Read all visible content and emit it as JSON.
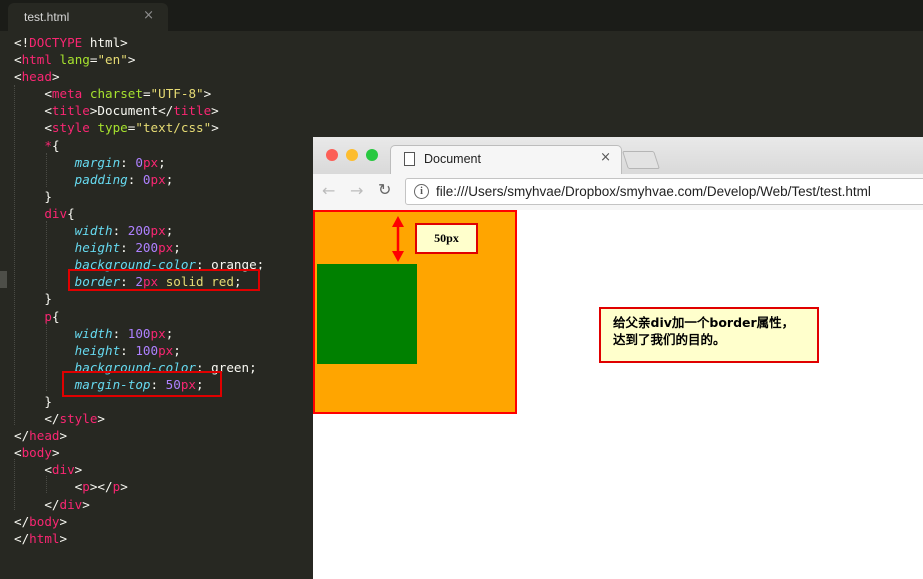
{
  "editor": {
    "tab": {
      "title": "test.html",
      "close": "×"
    },
    "lines": [
      [
        [
          "t-plain",
          "<!"
        ],
        [
          "t-tag",
          "DOCTYPE"
        ],
        [
          "t-plain",
          " html>"
        ]
      ],
      [
        [
          "t-plain",
          "<"
        ],
        [
          "t-tag",
          "html"
        ],
        [
          "t-plain",
          " "
        ],
        [
          "t-attr",
          "lang"
        ],
        [
          "t-plain",
          "="
        ],
        [
          "t-str",
          "\"en\""
        ],
        [
          "t-plain",
          ">"
        ]
      ],
      [
        [
          "t-plain",
          "<"
        ],
        [
          "t-tag",
          "head"
        ],
        [
          "t-plain",
          ">"
        ]
      ],
      [
        [
          "t-plain",
          "    <"
        ],
        [
          "t-tag",
          "meta"
        ],
        [
          "t-plain",
          " "
        ],
        [
          "t-attr",
          "charset"
        ],
        [
          "t-plain",
          "="
        ],
        [
          "t-str",
          "\"UTF-8\""
        ],
        [
          "t-plain",
          ">"
        ]
      ],
      [
        [
          "t-plain",
          "    <"
        ],
        [
          "t-tag",
          "title"
        ],
        [
          "t-plain",
          ">Document</"
        ],
        [
          "t-tag",
          "title"
        ],
        [
          "t-plain",
          ">"
        ]
      ],
      [
        [
          "t-plain",
          "    <"
        ],
        [
          "t-tag",
          "style"
        ],
        [
          "t-plain",
          " "
        ],
        [
          "t-attr",
          "type"
        ],
        [
          "t-plain",
          "="
        ],
        [
          "t-str",
          "\"text/css\""
        ],
        [
          "t-plain",
          ">"
        ]
      ],
      [
        [
          "t-plain",
          "    "
        ],
        [
          "t-tag",
          "*"
        ],
        [
          "t-plain",
          "{"
        ]
      ],
      [
        [
          "t-plain",
          "        "
        ],
        [
          "t-prop",
          "margin"
        ],
        [
          "t-plain",
          ": "
        ],
        [
          "t-num",
          "0"
        ],
        [
          "t-tag",
          "px"
        ],
        [
          "t-plain",
          ";"
        ]
      ],
      [
        [
          "t-plain",
          "        "
        ],
        [
          "t-prop",
          "padding"
        ],
        [
          "t-plain",
          ": "
        ],
        [
          "t-num",
          "0"
        ],
        [
          "t-tag",
          "px"
        ],
        [
          "t-plain",
          ";"
        ]
      ],
      [
        [
          "t-plain",
          "    }"
        ]
      ],
      [
        [
          "t-plain",
          "    "
        ],
        [
          "t-tag",
          "div"
        ],
        [
          "t-plain",
          "{"
        ]
      ],
      [
        [
          "t-plain",
          "        "
        ],
        [
          "t-prop",
          "width"
        ],
        [
          "t-plain",
          ": "
        ],
        [
          "t-num",
          "200"
        ],
        [
          "t-tag",
          "px"
        ],
        [
          "t-plain",
          ";"
        ]
      ],
      [
        [
          "t-plain",
          "        "
        ],
        [
          "t-prop",
          "height"
        ],
        [
          "t-plain",
          ": "
        ],
        [
          "t-num",
          "200"
        ],
        [
          "t-tag",
          "px"
        ],
        [
          "t-plain",
          ";"
        ]
      ],
      [
        [
          "t-plain",
          "        "
        ],
        [
          "t-prop",
          "background-color"
        ],
        [
          "t-plain",
          ": orange;"
        ]
      ],
      [
        [
          "t-plain",
          "        "
        ],
        [
          "t-prop",
          "border"
        ],
        [
          "t-plain",
          ": "
        ],
        [
          "t-num",
          "2"
        ],
        [
          "t-tag",
          "px"
        ],
        [
          "t-plain",
          " "
        ],
        [
          "t-str",
          "solid"
        ],
        [
          "t-plain",
          " "
        ],
        [
          "t-str",
          "red"
        ],
        [
          "t-plain",
          ";"
        ]
      ],
      [
        [
          "t-plain",
          "    }"
        ]
      ],
      [
        [
          "t-plain",
          "    "
        ],
        [
          "t-tag",
          "p"
        ],
        [
          "t-plain",
          "{"
        ]
      ],
      [
        [
          "t-plain",
          "        "
        ],
        [
          "t-prop",
          "width"
        ],
        [
          "t-plain",
          ": "
        ],
        [
          "t-num",
          "100"
        ],
        [
          "t-tag",
          "px"
        ],
        [
          "t-plain",
          ";"
        ]
      ],
      [
        [
          "t-plain",
          "        "
        ],
        [
          "t-prop",
          "height"
        ],
        [
          "t-plain",
          ": "
        ],
        [
          "t-num",
          "100"
        ],
        [
          "t-tag",
          "px"
        ],
        [
          "t-plain",
          ";"
        ]
      ],
      [
        [
          "t-plain",
          "        "
        ],
        [
          "t-prop",
          "background-color"
        ],
        [
          "t-plain",
          ": green;"
        ]
      ],
      [
        [
          "t-plain",
          "        "
        ],
        [
          "t-prop",
          "margin-top"
        ],
        [
          "t-plain",
          ": "
        ],
        [
          "t-num",
          "50"
        ],
        [
          "t-tag",
          "px"
        ],
        [
          "t-plain",
          ";"
        ]
      ],
      [
        [
          "t-plain",
          "    }"
        ]
      ],
      [
        [
          "t-plain",
          "    </"
        ],
        [
          "t-tag",
          "style"
        ],
        [
          "t-plain",
          ">"
        ]
      ],
      [
        [
          "t-plain",
          "</"
        ],
        [
          "t-tag",
          "head"
        ],
        [
          "t-plain",
          ">"
        ]
      ],
      [
        [
          "t-plain",
          "<"
        ],
        [
          "t-tag",
          "body"
        ],
        [
          "t-plain",
          ">"
        ]
      ],
      [
        [
          "t-plain",
          "    <"
        ],
        [
          "t-tag",
          "div"
        ],
        [
          "t-plain",
          ">"
        ]
      ],
      [
        [
          "t-plain",
          "        <"
        ],
        [
          "t-tag",
          "p"
        ],
        [
          "t-plain",
          "></"
        ],
        [
          "t-tag",
          "p"
        ],
        [
          "t-plain",
          ">"
        ]
      ],
      [
        [
          "t-plain",
          "    </"
        ],
        [
          "t-tag",
          "div"
        ],
        [
          "t-plain",
          ">"
        ]
      ],
      [
        [
          "t-plain",
          "</"
        ],
        [
          "t-tag",
          "body"
        ],
        [
          "t-plain",
          ">"
        ]
      ],
      [
        [
          "t-plain",
          "</"
        ],
        [
          "t-tag",
          "html"
        ],
        [
          "t-plain",
          ">"
        ]
      ]
    ]
  },
  "browser": {
    "tab_title": "Document",
    "tab_close": "×",
    "back": "←",
    "forward": "→",
    "reload": "↻",
    "info": "i",
    "url": "file:///Users/smyhvae/Dropbox/smyhvae.com/Develop/Web/Test/test.html",
    "traffic_colors": [
      "#fc5f57",
      "#fdbd2e",
      "#28c840"
    ]
  },
  "annotations": {
    "margin_label": "50px",
    "note": "给父亲div加一个border属性，达到了我们的目的。"
  }
}
